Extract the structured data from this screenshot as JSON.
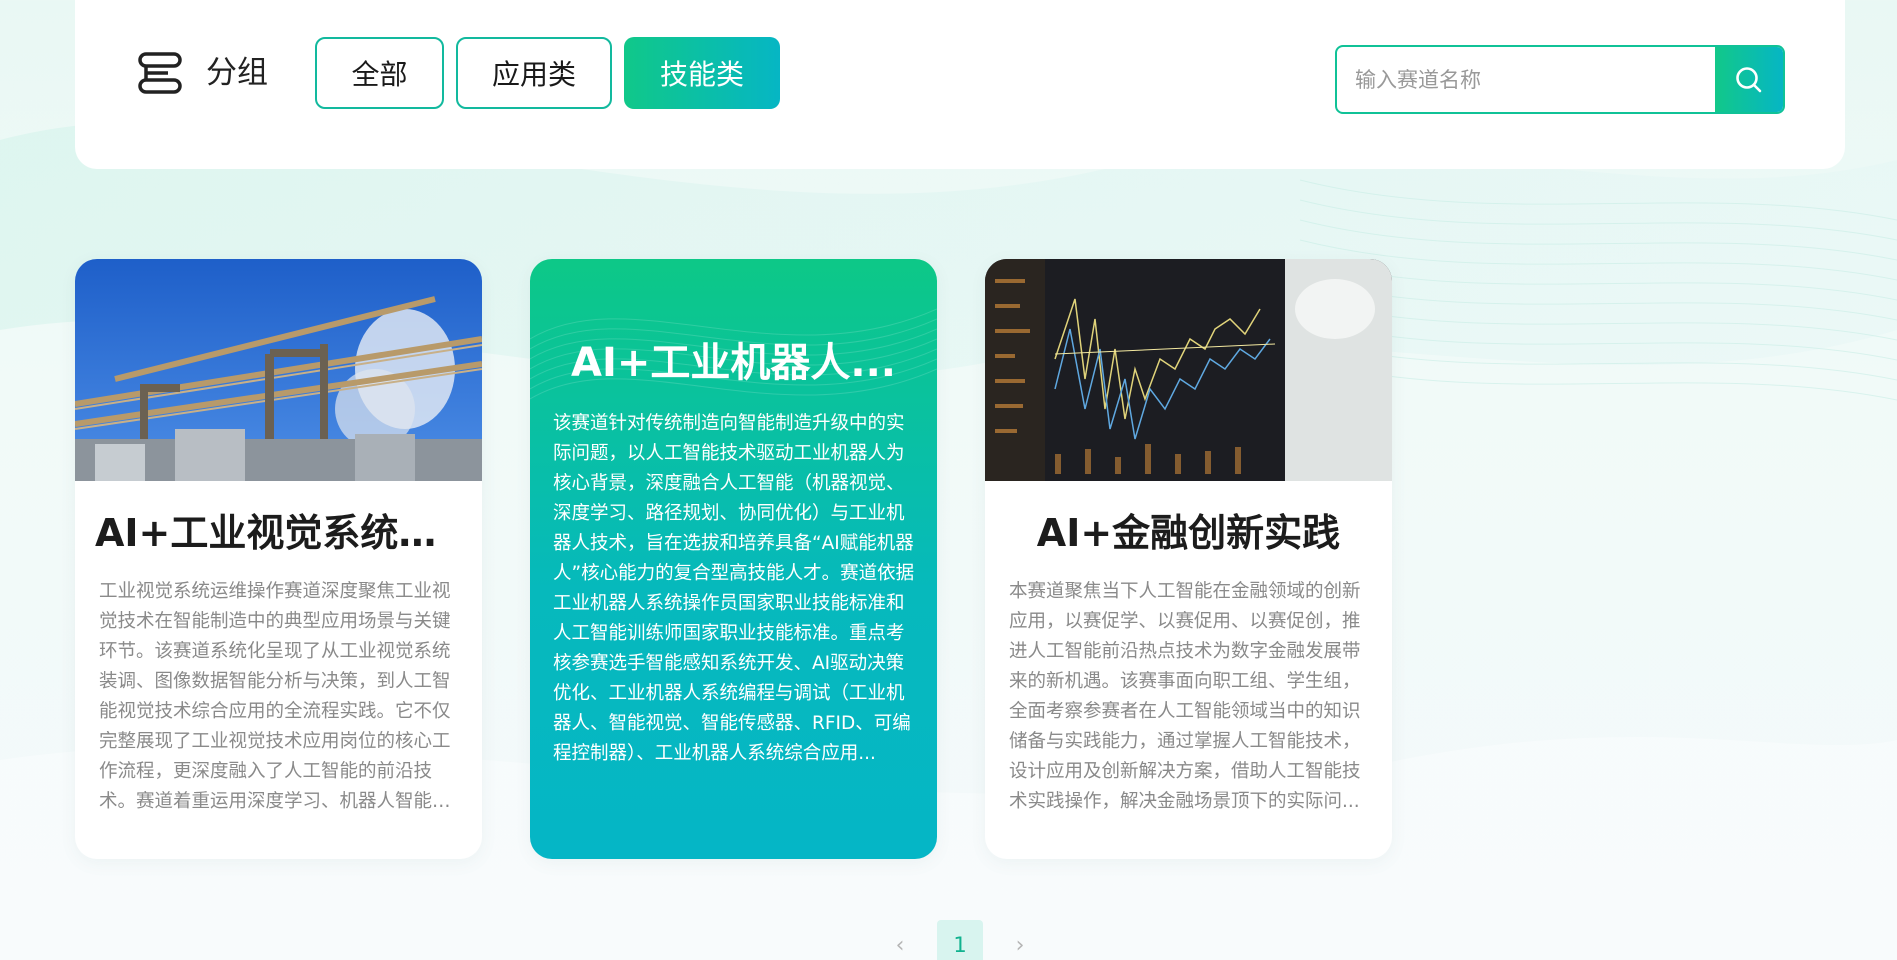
{
  "filter": {
    "group_label": "分组",
    "tabs": [
      {
        "label": "全部"
      },
      {
        "label": "应用类"
      },
      {
        "label": "技能类"
      }
    ],
    "active_tab": "技能类",
    "search_placeholder": "输入赛道名称"
  },
  "cards": [
    {
      "title": "AI+工业视觉系统运...",
      "description": "工业视觉系统运维操作赛道深度聚焦工业视觉技术在智能制造中的典型应用场景与关键环节。该赛道系统化呈现了从工业视觉系统装调、图像数据智能分析与决策，到人工智能视觉技术综合应用的全流程实践。它不仅完整展现了工业视觉技术应用岗位的核心工作流程，更深度融入了人工智能的前沿技术。赛道着重运用深度学习、机器人智能轨...",
      "image": "industrial-plant-photo"
    },
    {
      "title": "AI+工业机器人...",
      "description": "该赛道针对传统制造向智能制造升级中的实际问题，以人工智能技术驱动工业机器人为核心背景，深度融合人工智能（机器视觉、深度学习、路径规划、协同优化）与工业机器人技术，旨在选拔和培养具备“AI赋能机器人”核心能力的复合型高技能人才。赛道依据工业机器人系统操作员国家职业技能标准和人工智能训练师国家职业技能标准。重点考核参赛选手智能感知系统开发、AI驱动决策优化、工业机器人系统编程与调试（工业机器人、智能视觉、智能传感器、RFID、可编程控制器）、工业机器人系统综合应用..."
    },
    {
      "title": "AI+金融创新实践",
      "description": "本赛道聚焦当下人工智能在金融领域的创新应用，以赛促学、以赛促用、以赛促创，推进人工智能前沿热点技术为数字金融发展带来的新机遇。该赛事面向职工组、学生组，全面考察参赛者在人工智能领域当中的知识储备与实践能力，通过掌握人工智能技术，设计应用及创新解决方案，借助人工智能技术实践操作，解决金融场景顶下的实际问...",
      "image": "stock-chart-screen-photo"
    }
  ],
  "pagination": {
    "prev": "‹",
    "current_page": "1",
    "next": "›"
  },
  "colors": {
    "accent_green": "#10c889",
    "accent_cyan": "#06b6c4",
    "tab_border": "#12b99e"
  }
}
